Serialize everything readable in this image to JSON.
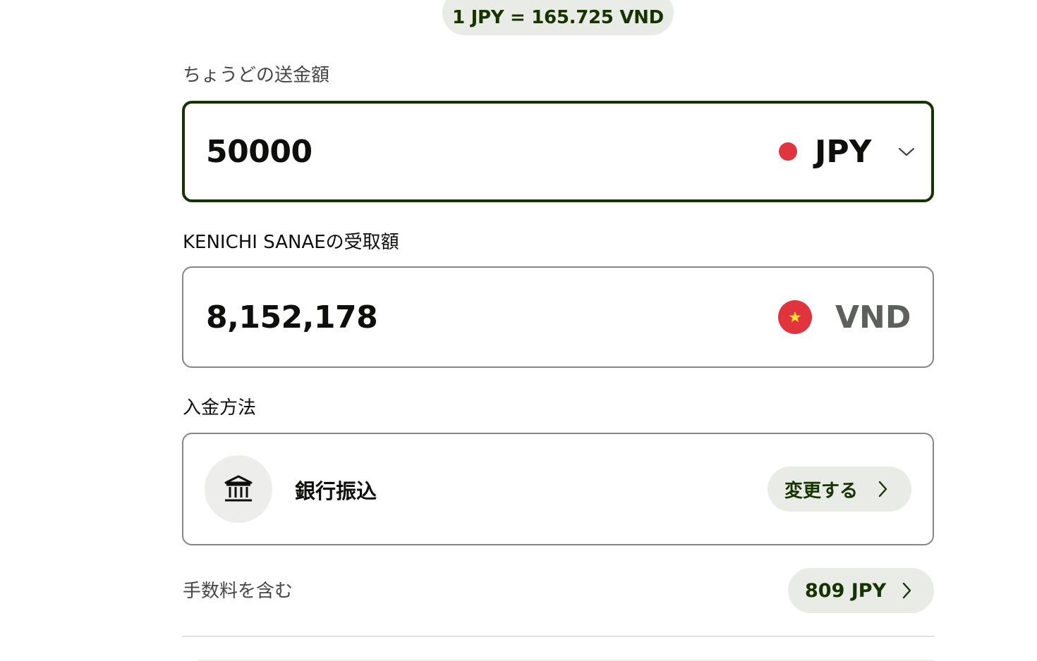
{
  "rate": {
    "text": "1 JPY = 165.725 VND"
  },
  "send": {
    "label": "ちょうどの送金額",
    "amount": "50000",
    "currency_code": "JPY",
    "flag_icon": "japan-flag-icon",
    "flag_color": "#e0353f"
  },
  "receive": {
    "label": "KENICHI SANAEの受取額",
    "amount": "8,152,178",
    "currency_code": "VND",
    "flag_icon": "vietnam-flag-icon",
    "flag_color": "#e0353f",
    "star_color": "#ffdd33"
  },
  "payment_method": {
    "label": "入金方法",
    "name": "銀行振込",
    "icon": "bank-icon",
    "change_label": "変更する"
  },
  "fee": {
    "label": "手数料を含む",
    "value": "809 JPY"
  },
  "colors": {
    "accent_dark_green": "#163300",
    "pill_background": "#e9ebe6",
    "border_grey": "#868685"
  }
}
